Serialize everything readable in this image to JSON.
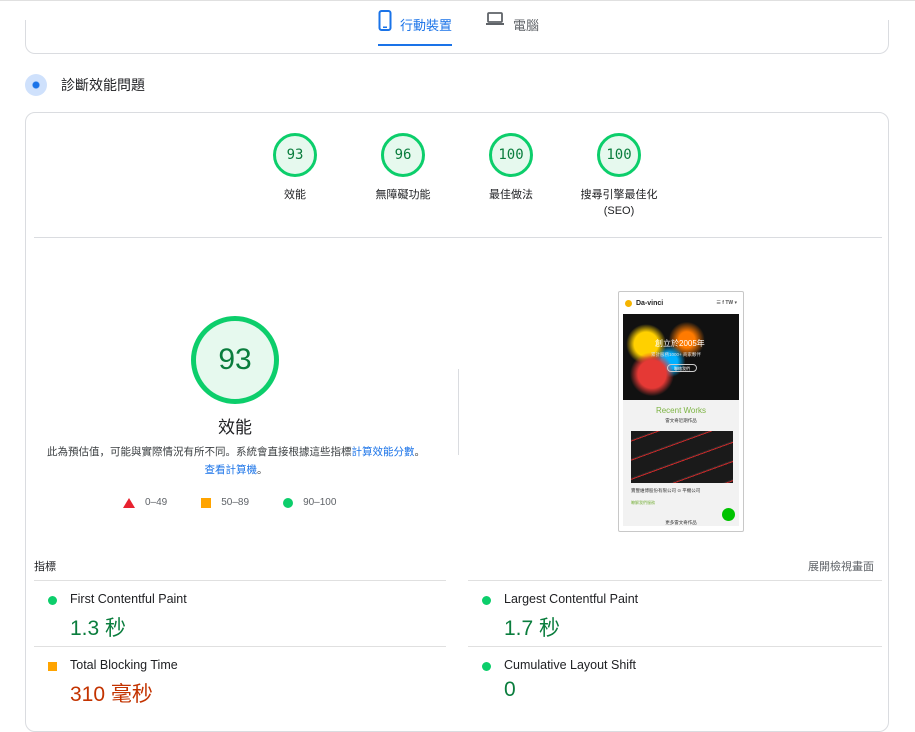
{
  "tabs": {
    "mobile": {
      "label": "行動裝置",
      "icon": "smartphone-icon",
      "color": "#1a73e8"
    },
    "desktop": {
      "label": "電腦",
      "icon": "laptop-icon"
    }
  },
  "diagnose": {
    "title": "診斷效能問題",
    "icon": "pagespeed-icon"
  },
  "scores": [
    {
      "value": "93",
      "label": "效能",
      "sublabel": ""
    },
    {
      "value": "96",
      "label": "無障礙功能",
      "sublabel": ""
    },
    {
      "value": "100",
      "label": "最佳做法",
      "sublabel": ""
    },
    {
      "value": "100",
      "label": "搜尋引擎最佳化",
      "sublabel": "(SEO)"
    }
  ],
  "performance": {
    "score": "93",
    "title": "效能",
    "note_text": "此為預估值，可能與實際情況有所不同。系統會直接根據這些指標",
    "note_link": "計算效能分數",
    "note_sep": "。",
    "calc_link": "查看計算機",
    "note_end": "。"
  },
  "legend": [
    {
      "shape": "triangle",
      "range": "0–49",
      "color": "#e8222f"
    },
    {
      "shape": "square",
      "range": "50–89",
      "color": "#ffa400"
    },
    {
      "shape": "circle",
      "range": "90–100",
      "color": "#0cce6b"
    }
  ],
  "screenshot": {
    "brand": "Da-vinci",
    "menu": "☰  f  TW ▾",
    "hero_title": "創立於2005年",
    "hero_sub": "累計服務1000+ 商家夥伴",
    "hero_button": "聯絡我們",
    "section_title": "Recent Works",
    "section_sub": "雷文奇近期作品",
    "caption": "實豐維博股份有限公司 ⊙ 平機公司",
    "caption_link": "瞭解我們服務",
    "footer": "更多雷文奇作品"
  },
  "metrics_header": {
    "label": "指標",
    "expand": "展開檢視畫面"
  },
  "metrics": [
    {
      "name": "First Contentful Paint",
      "value": "1.3 秒",
      "status": "good"
    },
    {
      "name": "Largest Contentful Paint",
      "value": "1.7 秒",
      "status": "good"
    },
    {
      "name": "Total Blocking Time",
      "value": "310 毫秒",
      "status": "average"
    },
    {
      "name": "Cumulative Layout Shift",
      "value": "0",
      "status": "good"
    }
  ]
}
